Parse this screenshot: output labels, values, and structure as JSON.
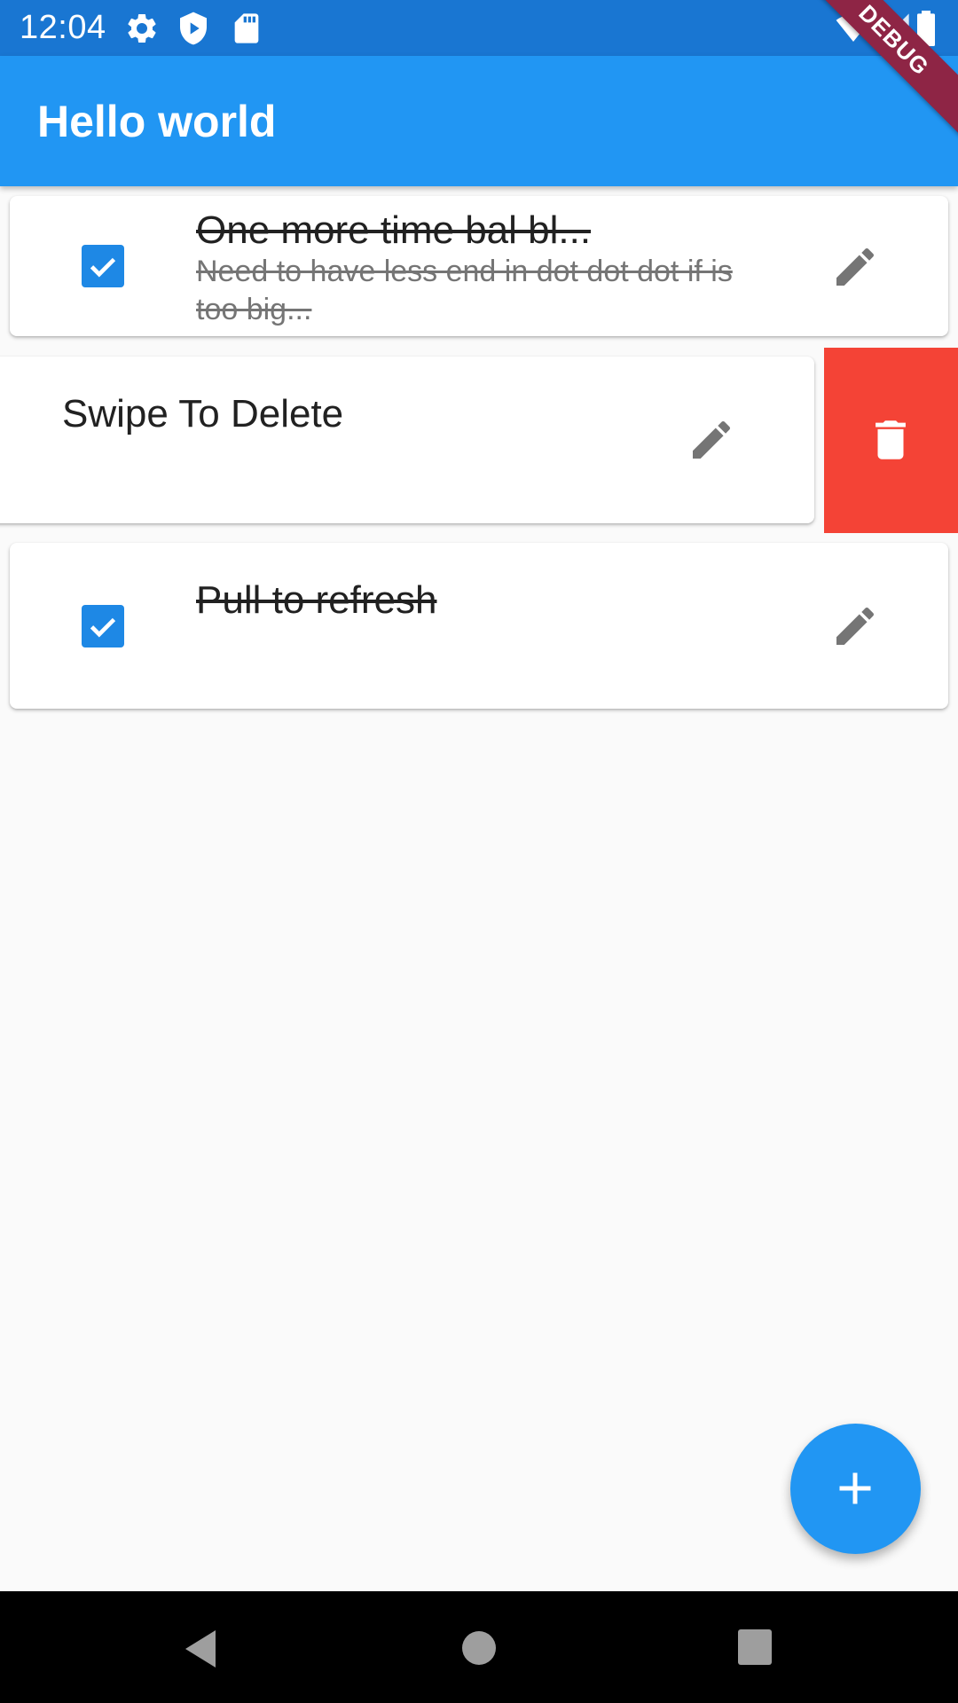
{
  "status_bar": {
    "time": "12:04",
    "icons": [
      "gear-icon",
      "shield-icon",
      "sd-card-icon",
      "wifi-icon",
      "signal-icon",
      "battery-icon"
    ]
  },
  "app_bar": {
    "title": "Hello world"
  },
  "debug_banner": "DEBUG",
  "todos": [
    {
      "title": "One more time bal bl...",
      "subtitle": "Need to have less end in dot dot dot if is too big...",
      "checked": true
    },
    {
      "title": "Swipe To Delete",
      "subtitle": "",
      "checked": false,
      "swiped": true
    },
    {
      "title": "Pull to refresh",
      "subtitle": "",
      "checked": true
    }
  ],
  "colors": {
    "status_bar": "#1976d2",
    "app_bar": "#2196f3",
    "checkbox": "#1e88e5",
    "delete": "#f44336",
    "fab": "#2196f3"
  },
  "fab": {
    "icon": "add-icon"
  },
  "nav_bar": {
    "icons": [
      "back-icon",
      "home-icon",
      "recents-icon"
    ]
  }
}
